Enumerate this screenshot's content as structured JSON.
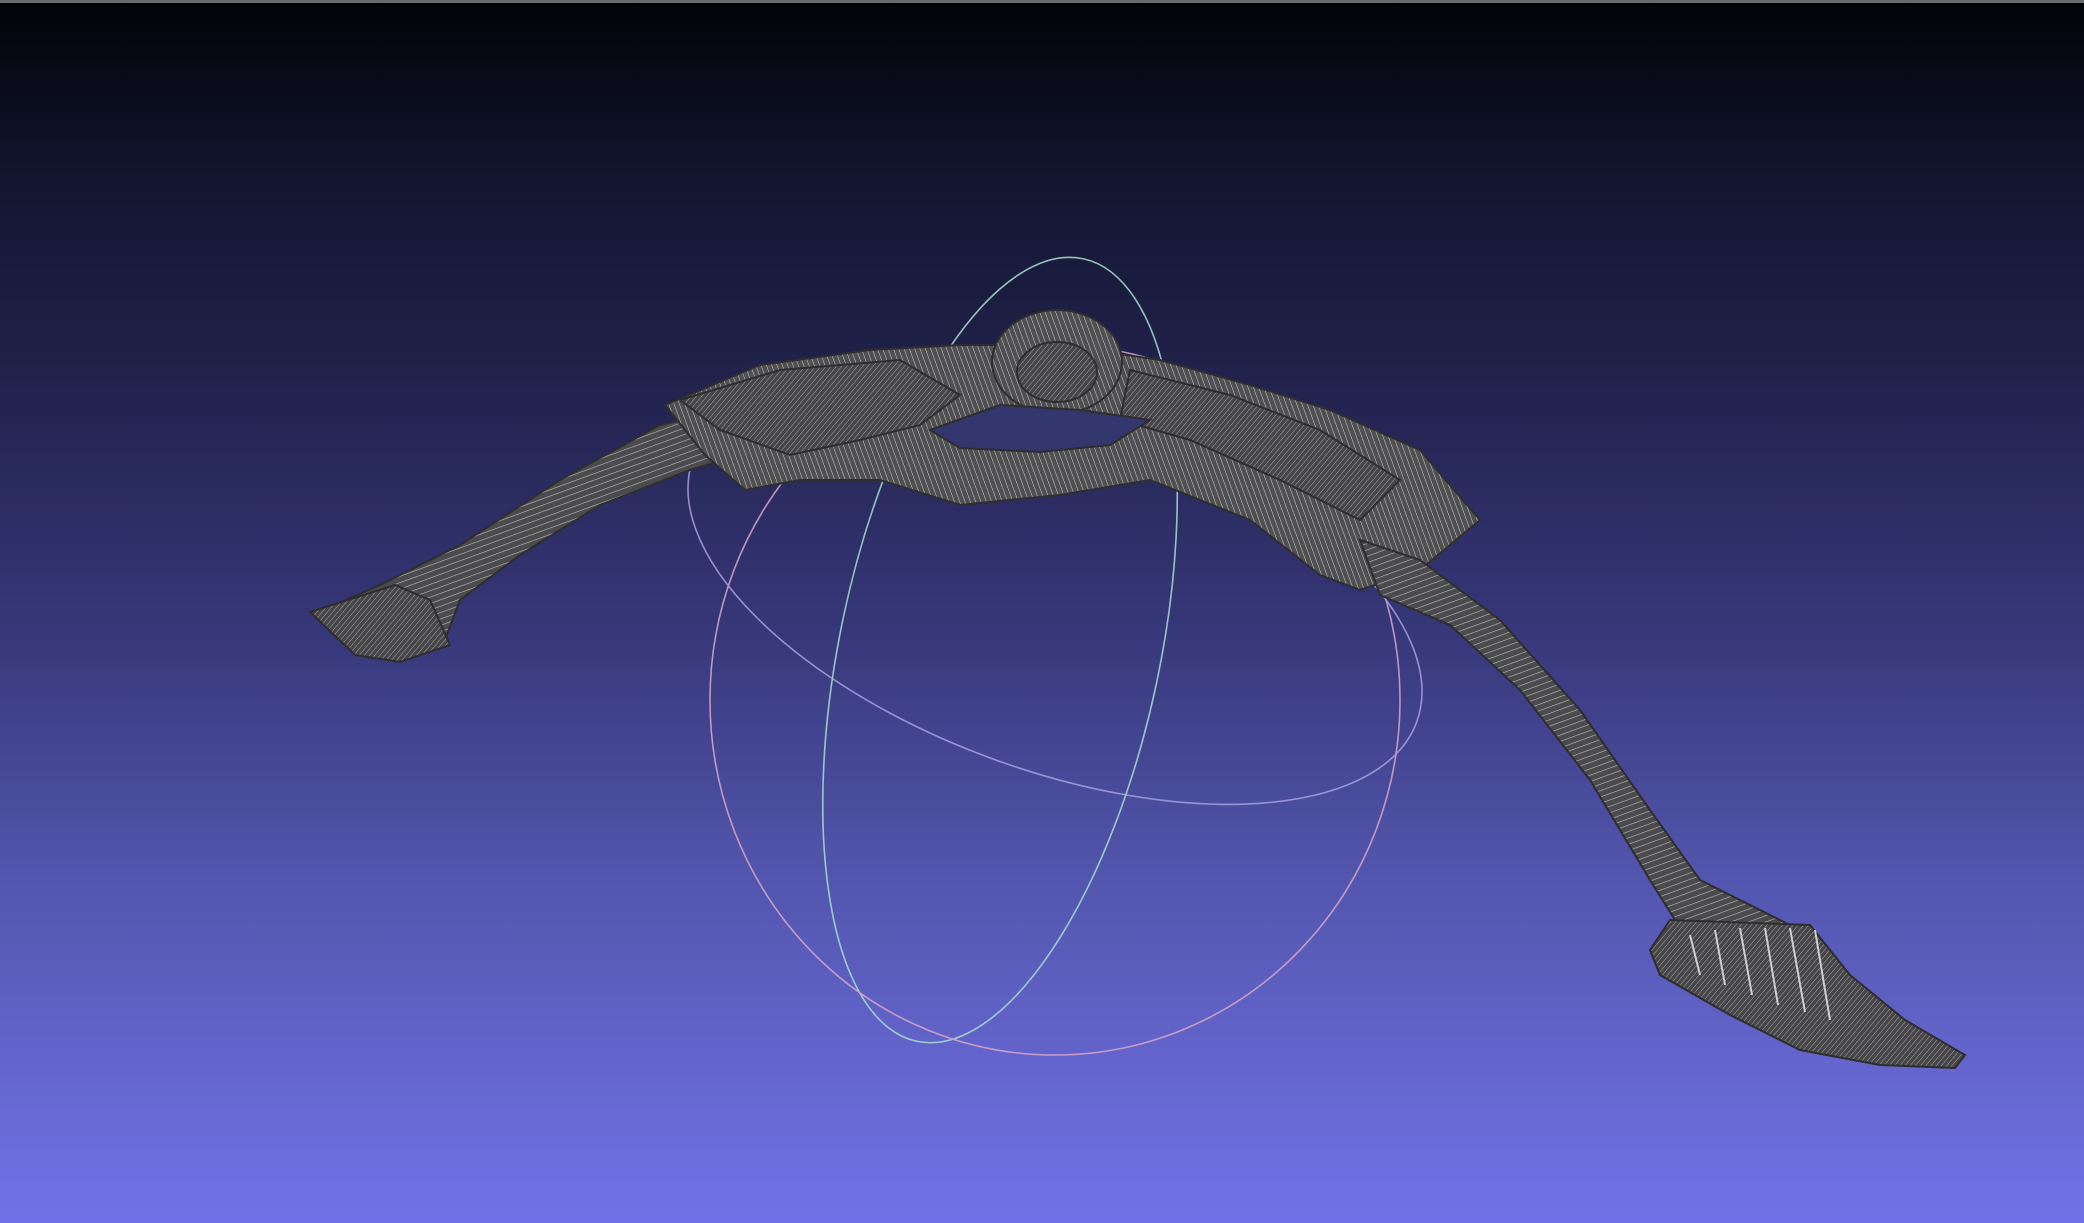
{
  "viewer": {
    "render_mode": "wireframe",
    "background_top": "#020208",
    "background_bottom": "#7272e8",
    "mesh_color": "#4a4a4a",
    "mesh_line_color": "#d0d0d0"
  },
  "trackball": {
    "colors": {
      "ring_a": "#a8e0d0",
      "ring_b": "#d8a8c8",
      "ring_c": "#a9a0e0"
    }
  },
  "icons": {
    "mesh": "wireframe-mesh-icon",
    "trackball": "trackball-icon"
  }
}
